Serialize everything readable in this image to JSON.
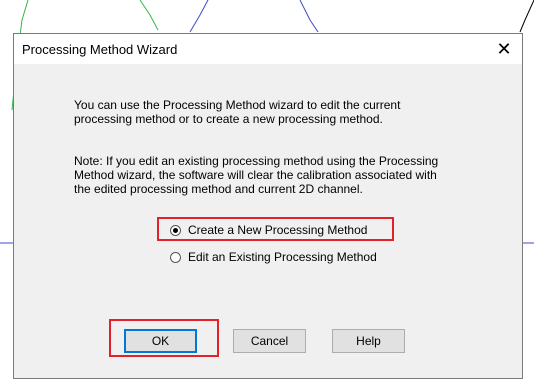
{
  "dialog": {
    "title": "Processing Method Wizard",
    "close_label": "✕",
    "intro_text": "You can use the Processing Method wizard to edit the current processing method or to create a new processing method.",
    "note_text": "Note:  If you edit an existing processing method using the Processing Method  wizard, the software will clear the calibration associated with the edited processing method and current 2D channel.",
    "options": [
      {
        "label": "Create a New Processing Method",
        "selected": true
      },
      {
        "label": "Edit an Existing Processing Method",
        "selected": false
      }
    ],
    "buttons": {
      "ok": "OK",
      "cancel": "Cancel",
      "help": "Help"
    }
  },
  "colors": {
    "highlight": "#e2212b",
    "background_line_green": "#22b14c",
    "background_line_blue": "#3f48cc"
  }
}
